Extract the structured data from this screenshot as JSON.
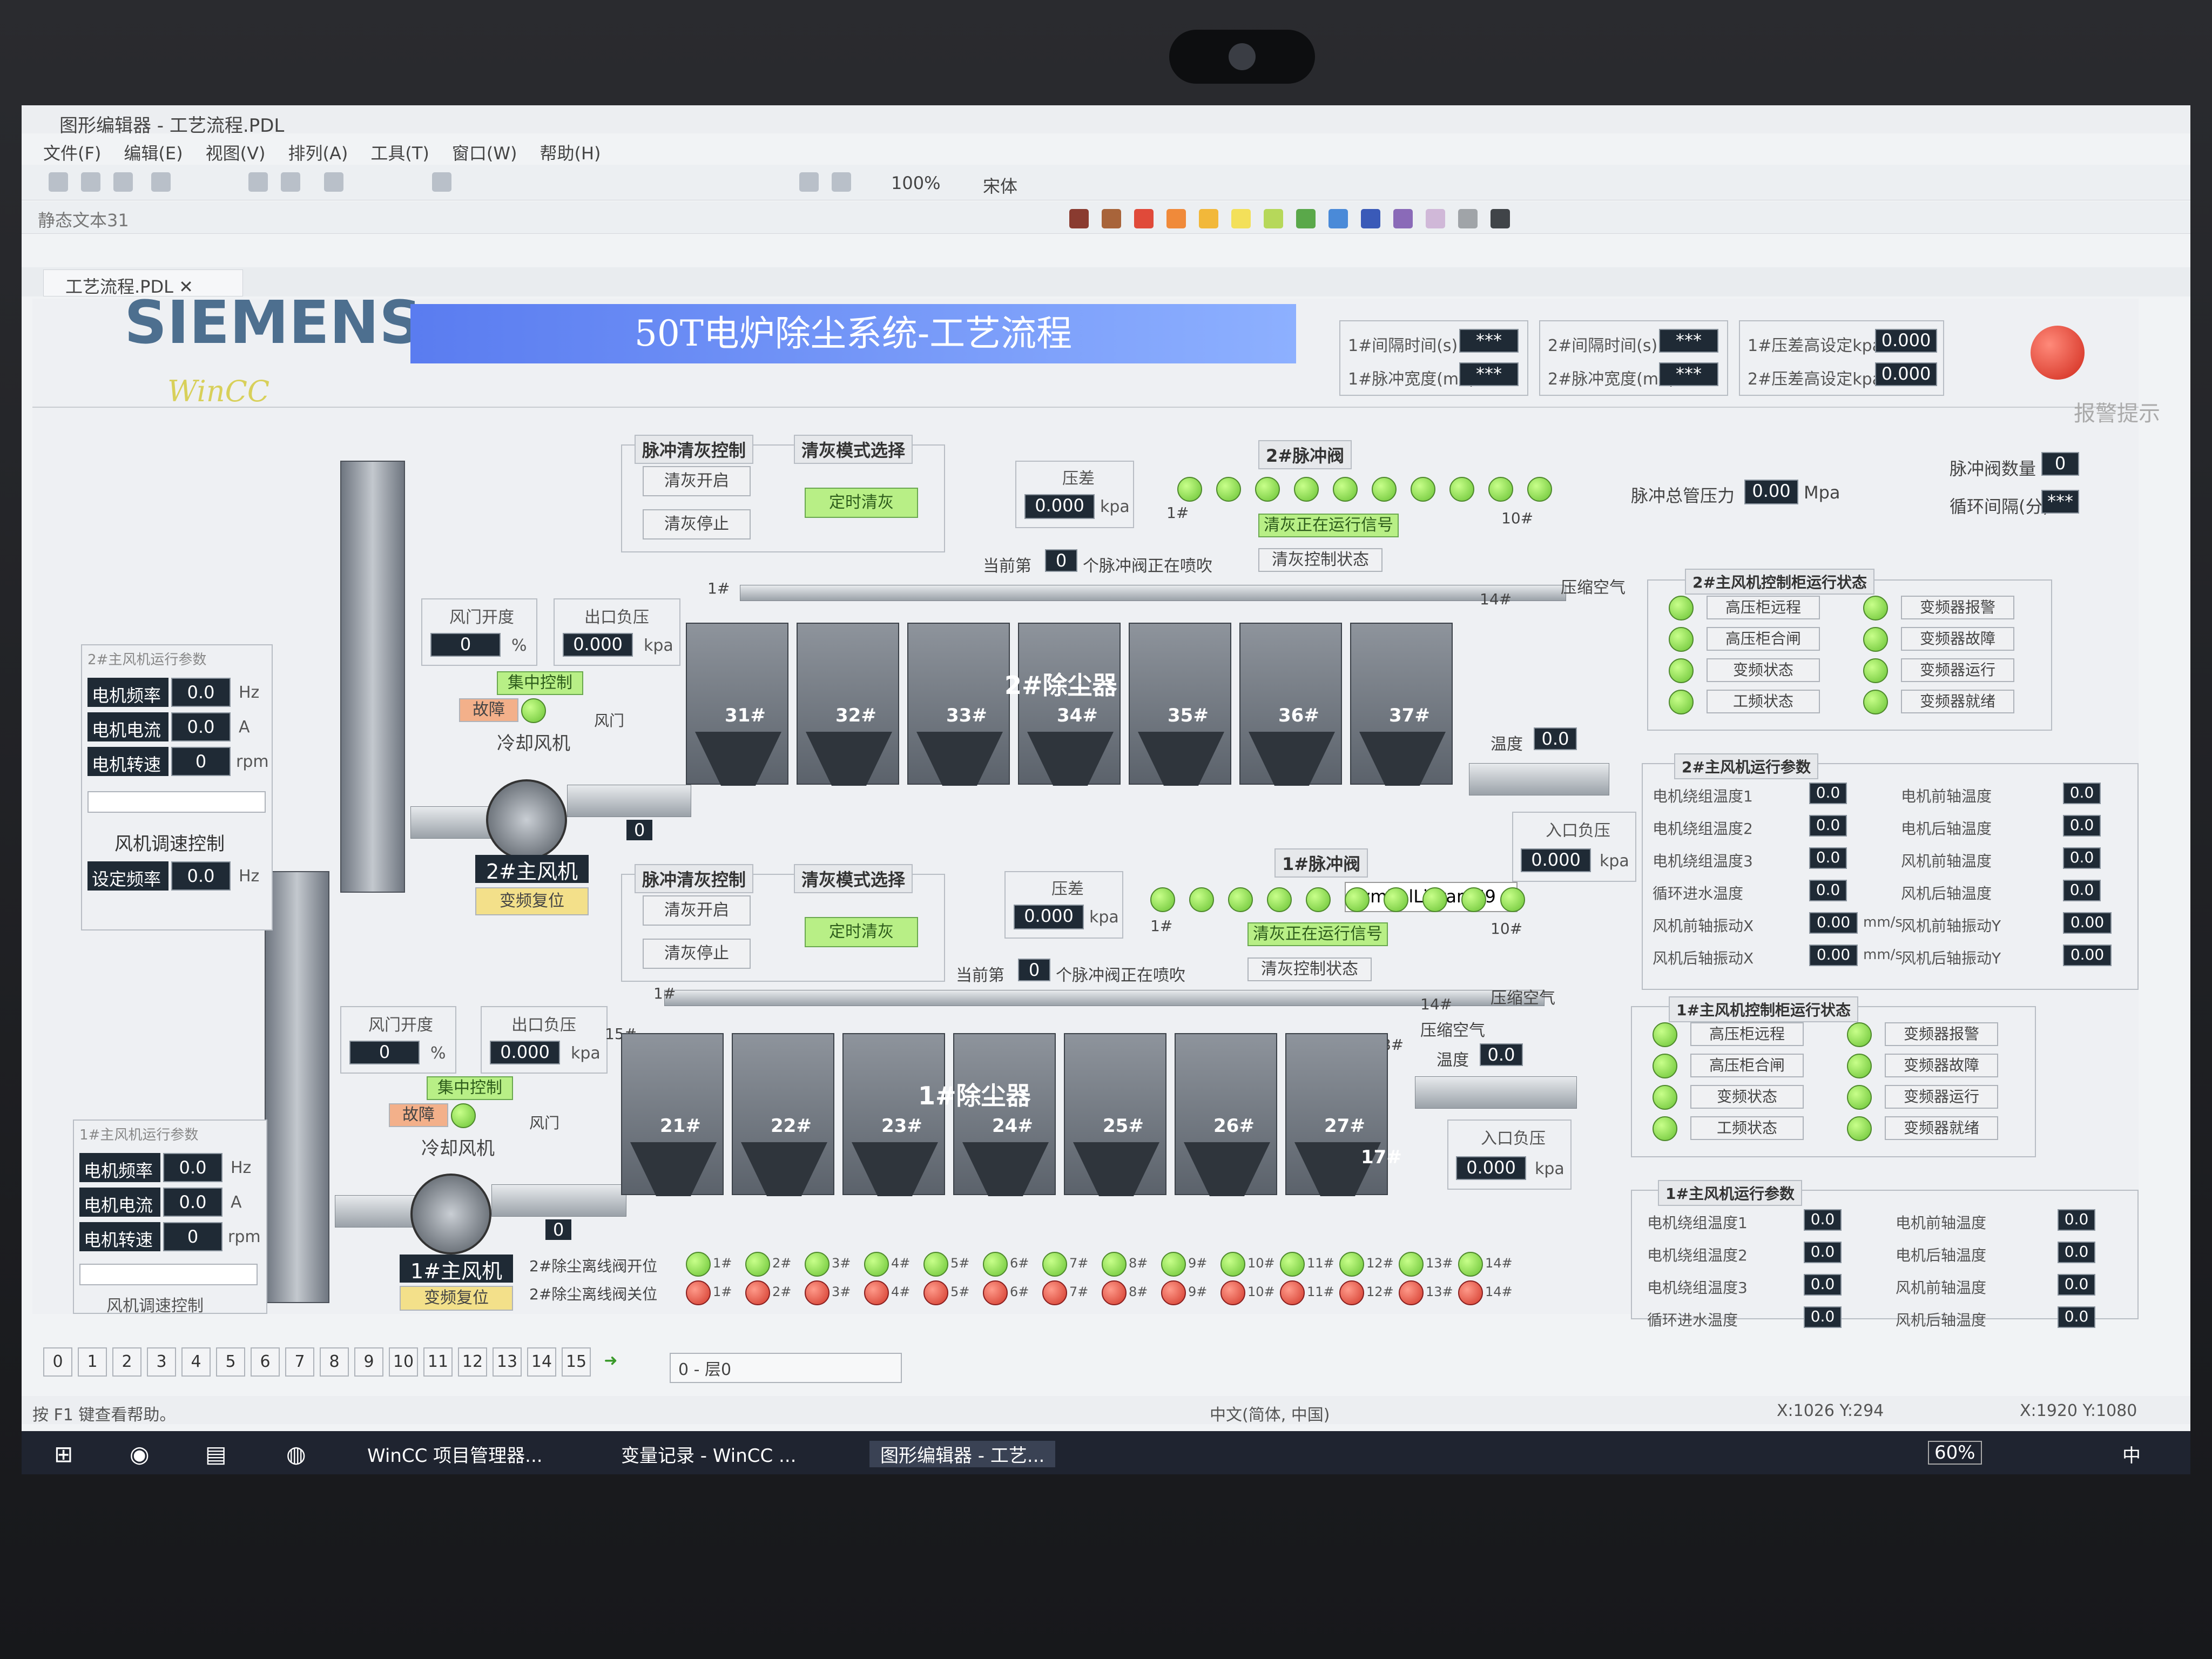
{
  "window": {
    "title": "图形编辑器 - 工艺流程.PDL"
  },
  "menu": [
    "文件(F)",
    "编辑(E)",
    "视图(V)",
    "排列(A)",
    "工具(T)",
    "窗口(W)",
    "帮助(H)"
  ],
  "toolbar": {
    "zoom": "100%",
    "font": "宋体",
    "object": "静态文本31"
  },
  "tab": {
    "label": "工艺流程.PDL"
  },
  "brand": {
    "logo": "SIEMENS",
    "sub": "WinCC",
    "title": "50T电炉除尘系统-工艺流程",
    "alarm": "报警提示"
  },
  "top_params": {
    "interval1": "1#间隔时间(s)",
    "width1": "1#脉冲宽度(mS)",
    "interval2": "2#间隔时间(s)",
    "width2": "2#脉冲宽度(mS)",
    "stars": "***",
    "dp1": "1#压差高设定kpa",
    "dp2": "2#压差高设定kpa",
    "dpval": "0.000",
    "pulse_pressure": "脉冲总管压力",
    "pp_val": "0.00",
    "pp_unit": "Mpa",
    "pulse_count": "脉冲阀数量",
    "pc_val": "0",
    "cycle": "循环间隔(分)",
    "cycle_val": "***"
  },
  "common": {
    "pulse_ctrl": "脉冲清灰控制",
    "mode": "清灰模式选择",
    "start": "清灰开启",
    "stop": "清灰停止",
    "timed": "定时清灰",
    "dp": "压差",
    "dp_val": "0.000",
    "kpa": "kpa",
    "running": "清灰正在运行信号",
    "ctrl_status": "清灰控制状态",
    "current": "当前第",
    "current_val": "0",
    "current_suffix": "个脉冲阀正在喷吹",
    "damper": "风门开度",
    "damper_val": "0",
    "pct": "%",
    "outlet": "出口负压",
    "outlet_val": "0.000",
    "central": "集中控制",
    "fault": "故障",
    "cooling": "冷却风机",
    "damper2": "风门",
    "inlet": "入口负压",
    "inlet_val": "0.000",
    "air": "压缩空气",
    "temp": "温度",
    "temp_val": "0.0",
    "pipe_val": "0",
    "tag": "SymbolLibrary69",
    "n1": "1#",
    "n10": "10#"
  },
  "valve2": {
    "title": "2#脉冲阀",
    "collector": "2#除尘器",
    "hoppers": [
      "31#",
      "32#",
      "33#",
      "34#",
      "35#",
      "36#",
      "37#"
    ],
    "left": "1#",
    "right": "14#"
  },
  "valve1": {
    "title": "1#脉冲阀",
    "collector": "1#除尘器",
    "hoppers": [
      "21#",
      "22#",
      "23#",
      "24#",
      "25#",
      "26#",
      "27#"
    ],
    "left": "1#",
    "left2": "15#",
    "right": "14#",
    "right2": "28#",
    "side": "17#"
  },
  "fan2": {
    "name": "2#主风机",
    "reset": "变频复位",
    "param": "2#主风机运行参数",
    "freq": "电机频率",
    "cur": "电机电流",
    "speed": "电机转速",
    "v": "0.0",
    "s": "0",
    "hz": "Hz",
    "a": "A",
    "rpm": "rpm",
    "adj": "风机调速控制",
    "set": "设定频率",
    "setv": "0.0"
  },
  "fan1": {
    "name": "1#主风机",
    "reset": "变频复位",
    "param": "1#主风机运行参数",
    "freq": "电机频率",
    "cur": "电机电流",
    "speed": "电机转速",
    "v": "0.0",
    "s": "0",
    "hz": "Hz",
    "a": "A",
    "rpm": "rpm",
    "adj": "风机调速控制"
  },
  "cab2": {
    "title": "2#主风机控制柜运行状态",
    "items": [
      "高压柜远程",
      "高压柜合闸",
      "变频状态",
      "工频状态"
    ],
    "items_r": [
      "变频器报警",
      "变频器故障",
      "变频器运行",
      "变频器就绪"
    ]
  },
  "cab1": {
    "title": "1#主风机控制柜运行状态",
    "items": [
      "高压柜远程",
      "高压柜合闸",
      "变频状态",
      "工频状态"
    ],
    "items_r": [
      "变频器报警",
      "变频器故障",
      "变频器运行",
      "变频器就绪"
    ]
  },
  "run2": {
    "title": "2#主风机运行参数",
    "l": [
      "电机绕组温度1",
      "电机绕组温度2",
      "电机绕组温度3",
      "循环进水温度",
      "风机前轴振动X",
      "风机后轴振动X"
    ],
    "r": [
      "电机前轴温度",
      "电机后轴温度",
      "风机前轴温度",
      "风机后轴温度",
      "风机前轴振动Y",
      "风机后轴振动Y"
    ],
    "v": "0.0",
    "vv": "0.00",
    "u": "mm/s"
  },
  "run1": {
    "title": "1#主风机运行参数",
    "l": [
      "电机绕组温度1",
      "电机绕组温度2",
      "电机绕组温度3",
      "循环进水温度"
    ],
    "r": [
      "电机前轴温度",
      "电机后轴温度",
      "风机前轴温度",
      "风机后轴温度"
    ],
    "v": "0.0"
  },
  "valves_row": {
    "open": "2#除尘离线阀开位",
    "close": "2#除尘离线阀关位",
    "nums": [
      "1#",
      "2#",
      "3#",
      "4#",
      "5#",
      "6#",
      "7#",
      "8#",
      "9#",
      "10#",
      "11#",
      "12#",
      "13#",
      "14#"
    ]
  },
  "pages": [
    "0",
    "1",
    "2",
    "3",
    "4",
    "5",
    "6",
    "7",
    "8",
    "9",
    "10",
    "11",
    "12",
    "13",
    "14",
    "15"
  ],
  "layer": "0 - 层0",
  "statusbar": {
    "help": "按 F1 键查看帮助。",
    "lang": "中文(简体, 中国)",
    "pos": "X:1026 Y:294",
    "size": "X:1920 Y:1080"
  },
  "taskbar": {
    "a": "WinCC 项目管理器...",
    "b": "变量记录 - WinCC ...",
    "c": "图形编辑器 - 工艺...",
    "batt": "60%",
    "ime": "中"
  }
}
